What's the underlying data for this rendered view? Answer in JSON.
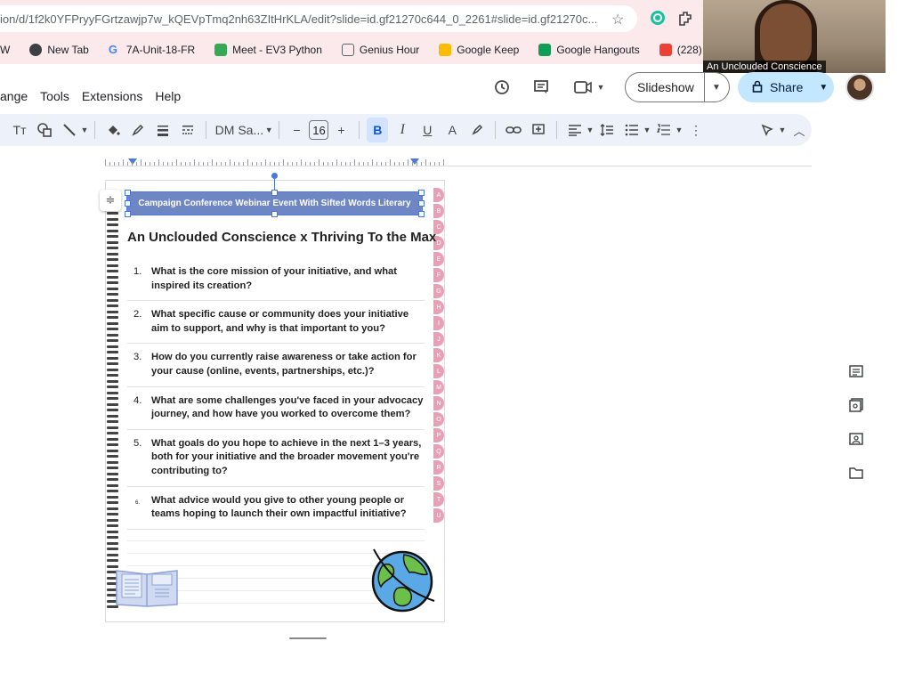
{
  "browser": {
    "url": "ion/d/1f2k0YFPryyFGrtzawjp7w_kQEVpTmq2nh63ZItHrKLA/edit?slide=id.gf21270c644_0_2261#slide=id.gf21270c...",
    "bookmarks": [
      {
        "label": "W",
        "color": "#3c4043"
      },
      {
        "label": "New Tab",
        "color": "#3c4043"
      },
      {
        "label": "7A-Unit-18-FR",
        "color": "#4285f4"
      },
      {
        "label": "Meet - EV3 Python",
        "color": "#34a853"
      },
      {
        "label": "Genius Hour",
        "color": "#5f6368"
      },
      {
        "label": "Google Keep",
        "color": "#fbbc04"
      },
      {
        "label": "Google Hangouts",
        "color": "#0f9d58"
      },
      {
        "label": "(228) 1-HOUR ST...",
        "color": "#ea4335"
      }
    ]
  },
  "webcam": {
    "label": "An Unclouded Conscience"
  },
  "menu": [
    "ange",
    "Tools",
    "Extensions",
    "Help"
  ],
  "actions": {
    "slideshow": "Slideshow",
    "share": "Share"
  },
  "toolbar": {
    "text_style": "Tт",
    "font": "DM Sa...",
    "font_size": "16",
    "bold": "B",
    "italic": "I",
    "underline": "U",
    "text_color": "A",
    "minus": "−",
    "plus": "+"
  },
  "slide": {
    "header": "Campaign Conference Webinar Event With Sifted Words Literary",
    "title": "An Unclouded Conscience x Thriving To the Max",
    "questions": [
      {
        "num": "1.",
        "text": "What is the core mission of your initiative, and what inspired its creation?"
      },
      {
        "num": "2.",
        "text": "What specific cause or community does your initiative aim to support, and why is that important to you?"
      },
      {
        "num": "3.",
        "text": "How do you currently raise awareness or take action for your cause (online, events, partnerships, etc.)?"
      },
      {
        "num": "4.",
        "text": "What are some challenges you've faced in your advocacy journey, and how have you worked to overcome them?"
      },
      {
        "num": "5.",
        "text": "What goals do you hope to achieve in the next 1–3 years, both for your initiative and the broader movement you're contributing to?"
      },
      {
        "num": "6.",
        "text": "What advice would you give to other young people or teams hoping to launch their own impactful initiative?"
      }
    ],
    "tabs": [
      "A",
      "B",
      "C",
      "D",
      "E",
      "F",
      "G",
      "H",
      "I",
      "J",
      "K",
      "L",
      "M",
      "N",
      "O",
      "P",
      "Q",
      "R",
      "S",
      "T",
      "U"
    ]
  }
}
